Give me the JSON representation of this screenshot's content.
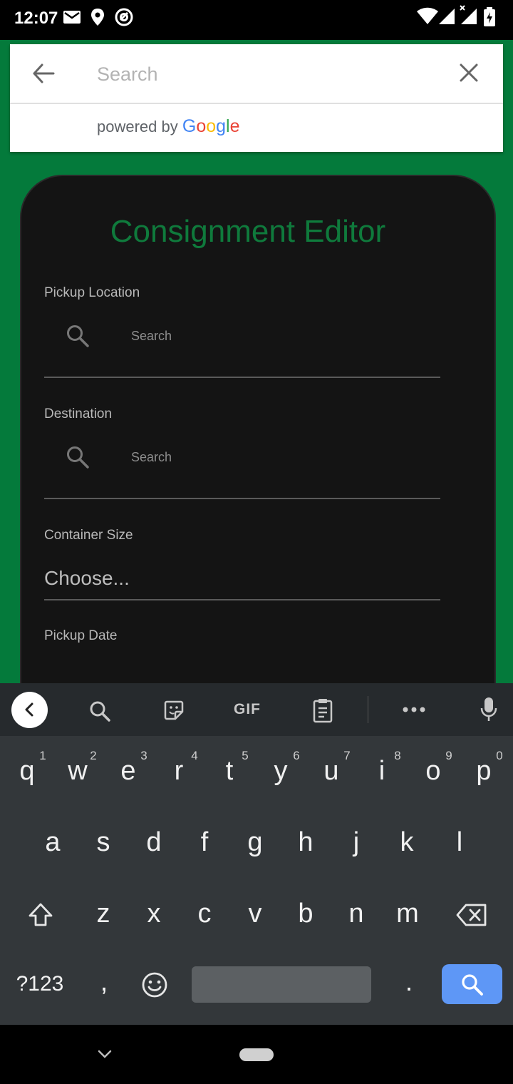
{
  "status_bar": {
    "time": "12:07"
  },
  "search": {
    "placeholder": "Search",
    "powered_by": "powered by",
    "google_letters": [
      {
        "char": "G",
        "color": "#4285F4"
      },
      {
        "char": "o",
        "color": "#EA4335"
      },
      {
        "char": "o",
        "color": "#FBBC05"
      },
      {
        "char": "g",
        "color": "#4285F4"
      },
      {
        "char": "l",
        "color": "#34A853"
      },
      {
        "char": "e",
        "color": "#EA4335"
      }
    ]
  },
  "editor": {
    "title": "Consignment Editor",
    "pickup_label": "Pickup Location",
    "pickup_placeholder": "Search",
    "destination_label": "Destination",
    "destination_placeholder": "Search",
    "container_label": "Container Size",
    "container_value": "Choose...",
    "date_label": "Pickup Date"
  },
  "keyboard": {
    "toolbar": {
      "gif": "GIF"
    },
    "row1": [
      "q",
      "w",
      "e",
      "r",
      "t",
      "y",
      "u",
      "i",
      "o",
      "p"
    ],
    "row1_hints": [
      "1",
      "2",
      "3",
      "4",
      "5",
      "6",
      "7",
      "8",
      "9",
      "0"
    ],
    "row2": [
      "a",
      "s",
      "d",
      "f",
      "g",
      "h",
      "j",
      "k",
      "l"
    ],
    "row3": [
      "z",
      "x",
      "c",
      "v",
      "b",
      "n",
      "m"
    ],
    "symbols": "?123",
    "comma": ",",
    "period": "."
  },
  "colors": {
    "accent": "#0f7a3c",
    "app_background": "#047a3b",
    "search_key": "#5e97f6"
  }
}
